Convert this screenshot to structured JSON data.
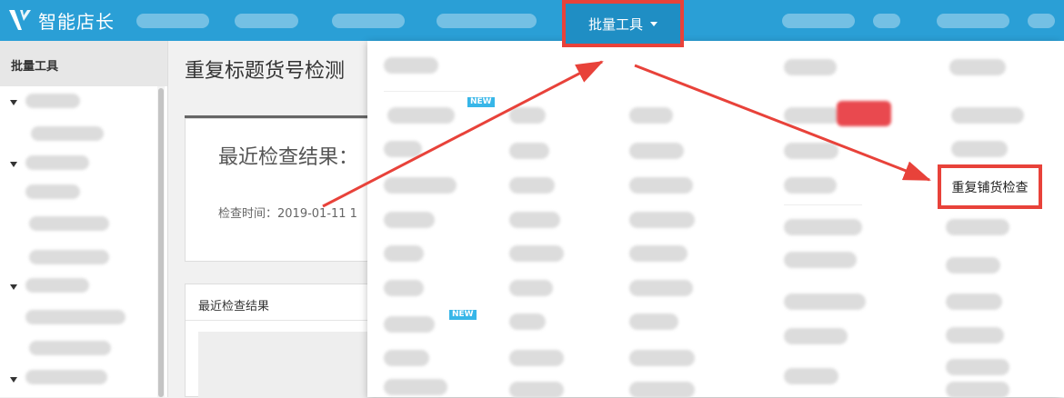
{
  "header": {
    "app_name": "智能店长",
    "active_menu": "批量工具",
    "nav_items_blurred": 5
  },
  "sidebar": {
    "section_title": "批量工具"
  },
  "main": {
    "page_title": "重复标题货号检测",
    "result_card": {
      "heading": "最近检查结果：",
      "time_label": "检查时间：2019-01-11 1"
    },
    "panel_title": "最近检查结果"
  },
  "dropdown": {
    "new_badge": "NEW",
    "highlighted_item": "重复铺货检查"
  },
  "annotations": {
    "color": "#e8423a"
  }
}
